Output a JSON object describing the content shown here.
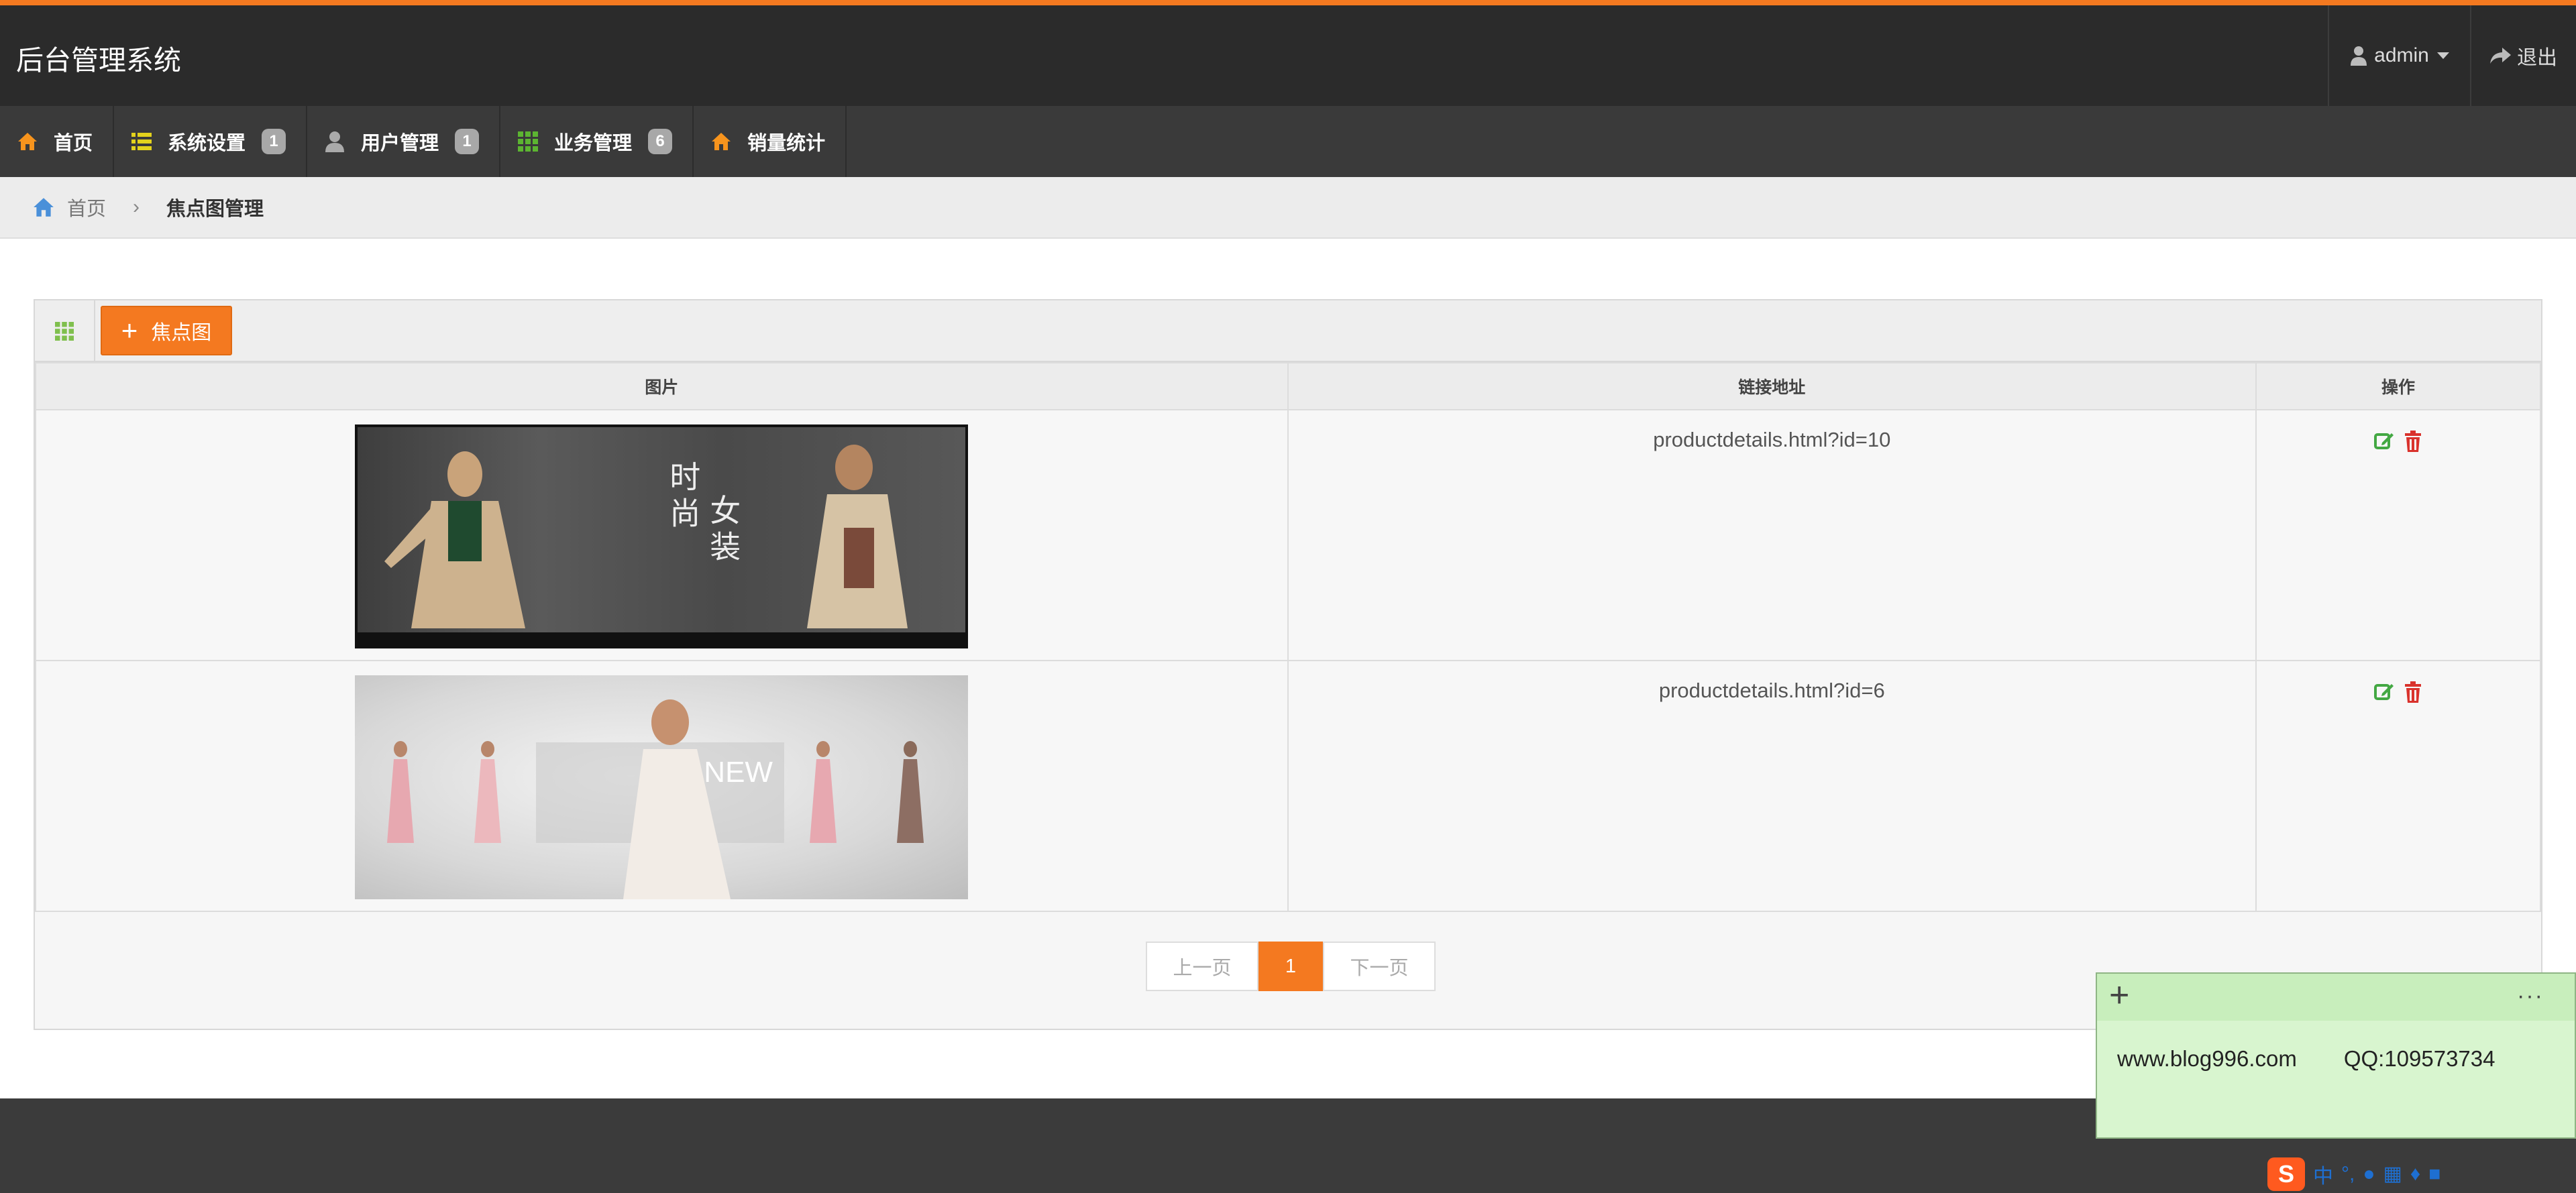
{
  "header": {
    "brand": "后台管理系统",
    "user": "admin",
    "logout": "退出"
  },
  "nav": [
    {
      "label": "首页",
      "icon": "home-icon",
      "badge": ""
    },
    {
      "label": "系统设置",
      "icon": "list-icon",
      "badge": "1"
    },
    {
      "label": "用户管理",
      "icon": "user-icon",
      "badge": "1"
    },
    {
      "label": "业务管理",
      "icon": "grid-icon",
      "badge": "6"
    },
    {
      "label": "销量统计",
      "icon": "home-icon",
      "badge": ""
    }
  ],
  "breadcrumb": {
    "home": "首页",
    "current": "焦点图管理"
  },
  "toolbar": {
    "add_label": "焦点图"
  },
  "table": {
    "headers": [
      "图片",
      "链接地址",
      "操作"
    ],
    "rows": [
      {
        "link": "productdetails.html?id=10",
        "banner_text1": "时尚",
        "banner_text2": "女装"
      },
      {
        "link": "productdetails.html?id=6",
        "banner_text1": "NEW",
        "banner_text2": ""
      }
    ]
  },
  "pager": {
    "prev": "上一页",
    "current": "1",
    "next": "下一页"
  },
  "note": {
    "site": "www.blog996.com",
    "qq": "QQ:109573734",
    "more": "···"
  },
  "tray": {
    "ime": "中"
  },
  "colors": {
    "accent": "#f47920",
    "edit": "#43a843",
    "delete": "#d9322c"
  }
}
